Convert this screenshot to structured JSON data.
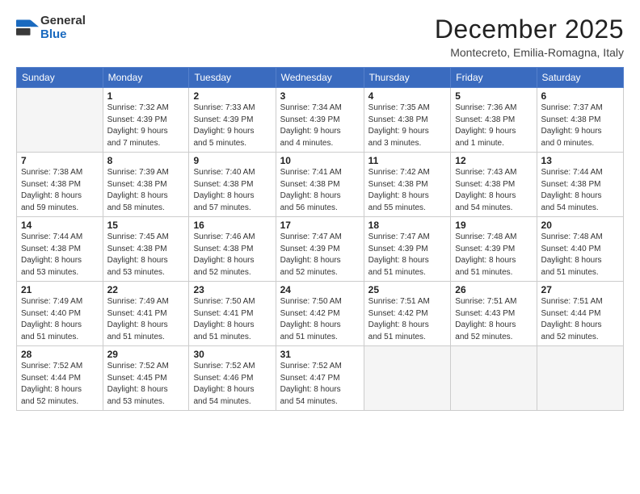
{
  "logo": {
    "general": "General",
    "blue": "Blue"
  },
  "title": "December 2025",
  "subtitle": "Montecreto, Emilia-Romagna, Italy",
  "days_of_week": [
    "Sunday",
    "Monday",
    "Tuesday",
    "Wednesday",
    "Thursday",
    "Friday",
    "Saturday"
  ],
  "weeks": [
    [
      {
        "day": "",
        "info": ""
      },
      {
        "day": "1",
        "info": "Sunrise: 7:32 AM\nSunset: 4:39 PM\nDaylight: 9 hours\nand 7 minutes."
      },
      {
        "day": "2",
        "info": "Sunrise: 7:33 AM\nSunset: 4:39 PM\nDaylight: 9 hours\nand 5 minutes."
      },
      {
        "day": "3",
        "info": "Sunrise: 7:34 AM\nSunset: 4:39 PM\nDaylight: 9 hours\nand 4 minutes."
      },
      {
        "day": "4",
        "info": "Sunrise: 7:35 AM\nSunset: 4:38 PM\nDaylight: 9 hours\nand 3 minutes."
      },
      {
        "day": "5",
        "info": "Sunrise: 7:36 AM\nSunset: 4:38 PM\nDaylight: 9 hours\nand 1 minute."
      },
      {
        "day": "6",
        "info": "Sunrise: 7:37 AM\nSunset: 4:38 PM\nDaylight: 9 hours\nand 0 minutes."
      }
    ],
    [
      {
        "day": "7",
        "info": "Sunrise: 7:38 AM\nSunset: 4:38 PM\nDaylight: 8 hours\nand 59 minutes."
      },
      {
        "day": "8",
        "info": "Sunrise: 7:39 AM\nSunset: 4:38 PM\nDaylight: 8 hours\nand 58 minutes."
      },
      {
        "day": "9",
        "info": "Sunrise: 7:40 AM\nSunset: 4:38 PM\nDaylight: 8 hours\nand 57 minutes."
      },
      {
        "day": "10",
        "info": "Sunrise: 7:41 AM\nSunset: 4:38 PM\nDaylight: 8 hours\nand 56 minutes."
      },
      {
        "day": "11",
        "info": "Sunrise: 7:42 AM\nSunset: 4:38 PM\nDaylight: 8 hours\nand 55 minutes."
      },
      {
        "day": "12",
        "info": "Sunrise: 7:43 AM\nSunset: 4:38 PM\nDaylight: 8 hours\nand 54 minutes."
      },
      {
        "day": "13",
        "info": "Sunrise: 7:44 AM\nSunset: 4:38 PM\nDaylight: 8 hours\nand 54 minutes."
      }
    ],
    [
      {
        "day": "14",
        "info": "Sunrise: 7:44 AM\nSunset: 4:38 PM\nDaylight: 8 hours\nand 53 minutes."
      },
      {
        "day": "15",
        "info": "Sunrise: 7:45 AM\nSunset: 4:38 PM\nDaylight: 8 hours\nand 53 minutes."
      },
      {
        "day": "16",
        "info": "Sunrise: 7:46 AM\nSunset: 4:38 PM\nDaylight: 8 hours\nand 52 minutes."
      },
      {
        "day": "17",
        "info": "Sunrise: 7:47 AM\nSunset: 4:39 PM\nDaylight: 8 hours\nand 52 minutes."
      },
      {
        "day": "18",
        "info": "Sunrise: 7:47 AM\nSunset: 4:39 PM\nDaylight: 8 hours\nand 51 minutes."
      },
      {
        "day": "19",
        "info": "Sunrise: 7:48 AM\nSunset: 4:39 PM\nDaylight: 8 hours\nand 51 minutes."
      },
      {
        "day": "20",
        "info": "Sunrise: 7:48 AM\nSunset: 4:40 PM\nDaylight: 8 hours\nand 51 minutes."
      }
    ],
    [
      {
        "day": "21",
        "info": "Sunrise: 7:49 AM\nSunset: 4:40 PM\nDaylight: 8 hours\nand 51 minutes."
      },
      {
        "day": "22",
        "info": "Sunrise: 7:49 AM\nSunset: 4:41 PM\nDaylight: 8 hours\nand 51 minutes."
      },
      {
        "day": "23",
        "info": "Sunrise: 7:50 AM\nSunset: 4:41 PM\nDaylight: 8 hours\nand 51 minutes."
      },
      {
        "day": "24",
        "info": "Sunrise: 7:50 AM\nSunset: 4:42 PM\nDaylight: 8 hours\nand 51 minutes."
      },
      {
        "day": "25",
        "info": "Sunrise: 7:51 AM\nSunset: 4:42 PM\nDaylight: 8 hours\nand 51 minutes."
      },
      {
        "day": "26",
        "info": "Sunrise: 7:51 AM\nSunset: 4:43 PM\nDaylight: 8 hours\nand 52 minutes."
      },
      {
        "day": "27",
        "info": "Sunrise: 7:51 AM\nSunset: 4:44 PM\nDaylight: 8 hours\nand 52 minutes."
      }
    ],
    [
      {
        "day": "28",
        "info": "Sunrise: 7:52 AM\nSunset: 4:44 PM\nDaylight: 8 hours\nand 52 minutes."
      },
      {
        "day": "29",
        "info": "Sunrise: 7:52 AM\nSunset: 4:45 PM\nDaylight: 8 hours\nand 53 minutes."
      },
      {
        "day": "30",
        "info": "Sunrise: 7:52 AM\nSunset: 4:46 PM\nDaylight: 8 hours\nand 54 minutes."
      },
      {
        "day": "31",
        "info": "Sunrise: 7:52 AM\nSunset: 4:47 PM\nDaylight: 8 hours\nand 54 minutes."
      },
      {
        "day": "",
        "info": ""
      },
      {
        "day": "",
        "info": ""
      },
      {
        "day": "",
        "info": ""
      }
    ]
  ]
}
